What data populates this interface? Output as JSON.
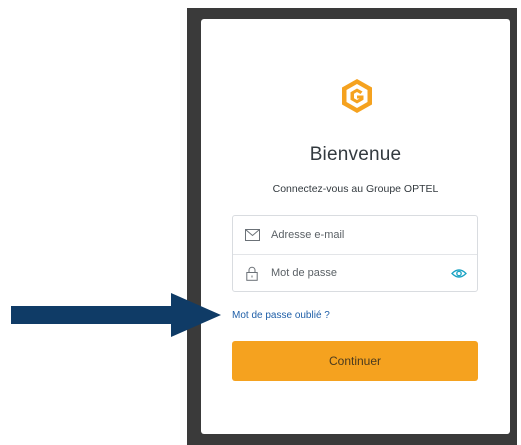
{
  "header": {
    "title": "Bienvenue",
    "subtitle": "Connectez-vous au Groupe OPTEL"
  },
  "form": {
    "email_placeholder": "Adresse e-mail",
    "password_placeholder": "Mot de passe"
  },
  "links": {
    "forgot_password": "Mot de passe oublié ?"
  },
  "actions": {
    "continue_label": "Continuer"
  },
  "icons": {
    "logo": "optel-logo-icon",
    "email": "envelope-icon",
    "password": "lock-icon",
    "toggle_visibility": "eye-icon",
    "annotation": "arrow-right-icon"
  },
  "colors": {
    "brand_orange": "#f5a21f",
    "link_blue": "#1f5fa8",
    "eye_teal": "#1aa3c4",
    "arrow_navy": "#0f3b66",
    "frame_dark": "#3a3a3a"
  }
}
